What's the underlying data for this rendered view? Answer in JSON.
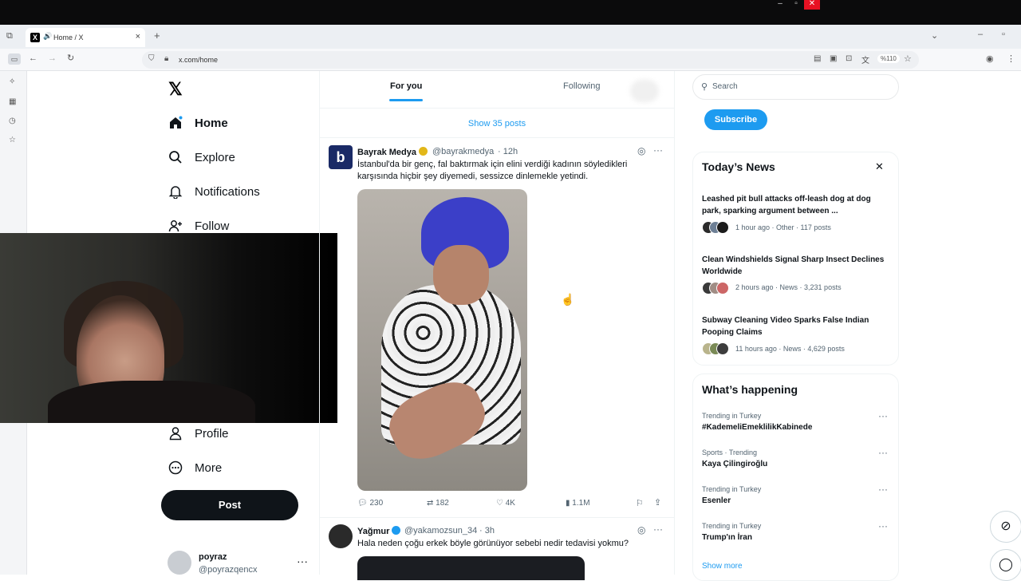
{
  "browser": {
    "tab_title": "Home / X",
    "tab_favicon": "X",
    "url": "x.com/home",
    "zoom": "%110"
  },
  "nav": {
    "logo": "𝕏",
    "items": [
      {
        "label": "Home",
        "icon": "home-icon"
      },
      {
        "label": "Explore",
        "icon": "search-icon"
      },
      {
        "label": "Notifications",
        "icon": "bell-icon"
      },
      {
        "label": "Follow",
        "icon": "follow-icon"
      },
      {
        "label": "Profile",
        "icon": "person-icon"
      },
      {
        "label": "More",
        "icon": "more-circle-icon"
      }
    ],
    "post_button": "Post",
    "account": {
      "name": "poyraz",
      "handle": "@poyrazqencx"
    }
  },
  "feed": {
    "tabs": [
      "For you",
      "Following"
    ],
    "show_posts": "Show 35 posts",
    "tweets": [
      {
        "name": "Bayrak Medya",
        "handle": "@bayrakmedya",
        "time": "· 12h",
        "avatar_letter": "b",
        "text": "İstanbul'da bir genç, fal baktırmak için elini verdiği kadının söyledikleri karşısında hiçbir şey diyemedi, sessizce dinlemekle yetindi.",
        "replies": "230",
        "reposts": "182",
        "likes": "4K",
        "views": "1.1M"
      },
      {
        "name": "Yağmur",
        "handle": "@yakamozsun_34",
        "time": "· 3h",
        "text": "Hala  neden  çoğu erkek böyle  görünüyor sebebi nedir  tedavisi  yokmu?"
      }
    ]
  },
  "sidebar": {
    "search_placeholder": "Search",
    "subscribe": "Subscribe",
    "news_title": "Today’s News",
    "news": [
      {
        "title": "Leashed pit bull attacks off-leash dog at dog park, sparking argument between ...",
        "meta": "1 hour ago · Other · 117 posts"
      },
      {
        "title": "Clean Windshields Signal Sharp Insect Declines Worldwide",
        "meta": "2 hours ago · News · 3,231 posts"
      },
      {
        "title": "Subway Cleaning Video Sparks False Indian Pooping Claims",
        "meta": "11 hours ago · News · 4,629 posts"
      }
    ],
    "happening_title": "What’s happening",
    "trends": [
      {
        "context": "Trending in Turkey",
        "name": "#KademeliEmeklilikKabinede"
      },
      {
        "context": "Sports · Trending",
        "name": "Kaya Çilingiroğlu"
      },
      {
        "context": "Trending in Turkey",
        "name": "Esenler"
      },
      {
        "context": "Trending in Turkey",
        "name": "Trump'ın İran"
      }
    ],
    "show_more": "Show more"
  },
  "colors": {
    "accent": "#1d9bf0",
    "text": "#0f1419",
    "muted": "#536471",
    "verified_gold": "#e2b719"
  }
}
